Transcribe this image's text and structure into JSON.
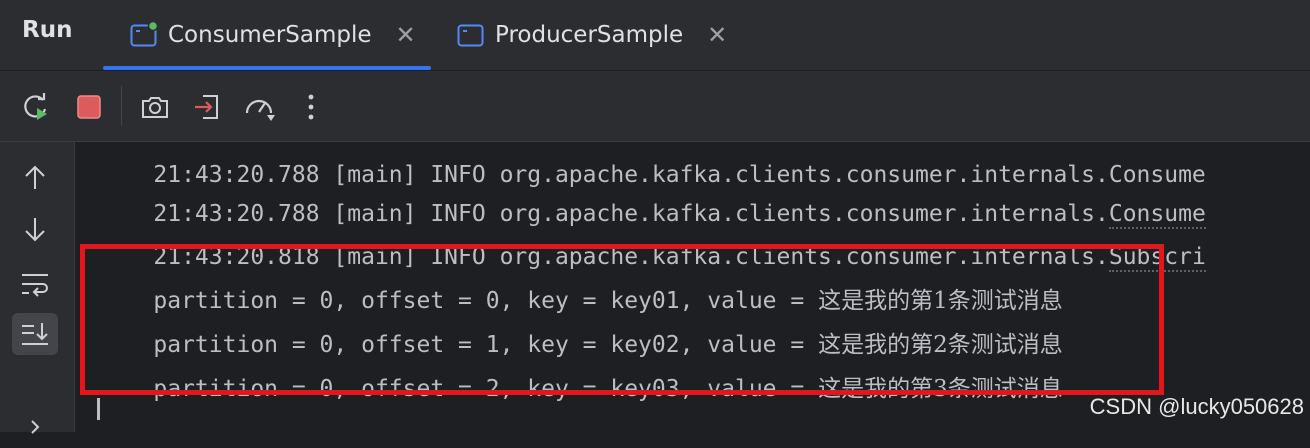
{
  "panel": {
    "title": "Run"
  },
  "tabs": [
    {
      "label": "ConsumerSample",
      "active": true,
      "running": true
    },
    {
      "label": "ProducerSample",
      "active": false,
      "running": false
    }
  ],
  "toolbar": {
    "icons": [
      "rerun-icon",
      "stop-icon",
      "screenshot-icon",
      "exit-icon",
      "profiler-icon",
      "more-icon"
    ]
  },
  "gutter": {
    "icons": [
      "arrow-up-icon",
      "arrow-down-icon",
      "soft-wrap-icon",
      "scroll-to-end-icon",
      "chevron-right-icon"
    ]
  },
  "console": {
    "lines": [
      {
        "prefix": "21:43:20.788 [main] INFO org.apache.kafka.clients.consumer.internals.",
        "tail": "Consume"
      },
      {
        "prefix": "21:43:20.818 [main] INFO org.apache.kafka.clients.consumer.internals.",
        "tail": "Subscri"
      }
    ],
    "top_partial": "21:43:20.788 [main] INFO org.apache.kafka.clients.consumer.internals.Consume",
    "records": [
      {
        "text": "partition = 0, offset = 0, key = key01, value = ",
        "message": "这是我的第1条测试消息"
      },
      {
        "text": "partition = 0, offset = 1, key = key02, value = ",
        "message": "这是我的第2条测试消息"
      },
      {
        "text": "partition = 0, offset = 2, key = key03, value = ",
        "message": "这是我的第3条测试消息"
      }
    ]
  },
  "colors": {
    "accent": "#3574f0",
    "running_dot": "#5fb865",
    "stop": "#db5c5c",
    "highlight_box": "#e3161b"
  },
  "watermark": "CSDN @lucky050628"
}
